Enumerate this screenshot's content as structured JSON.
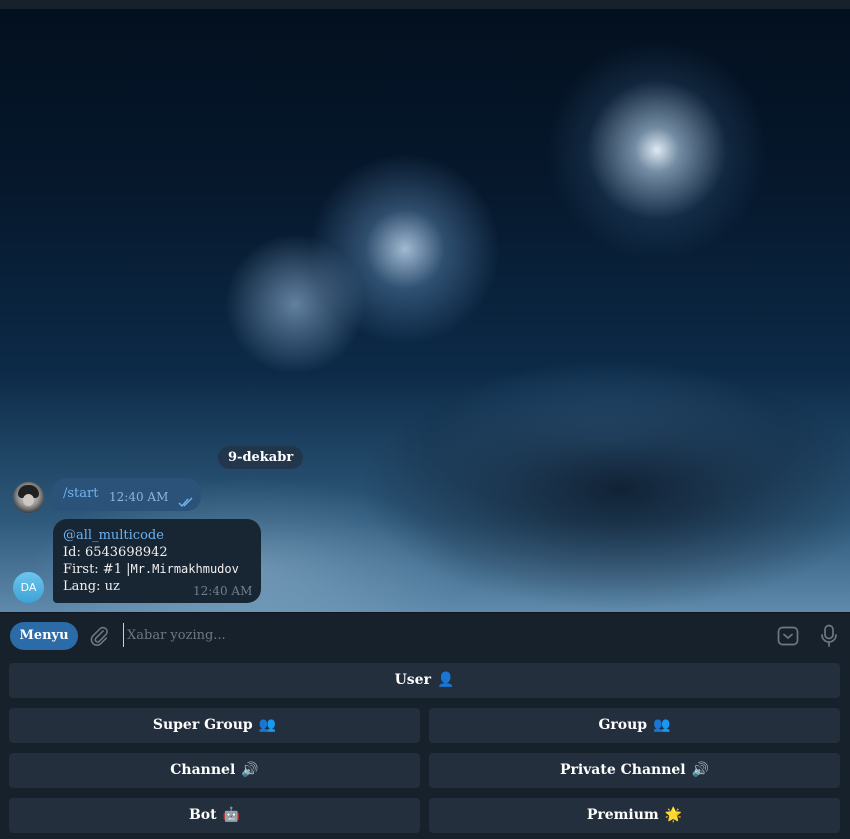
{
  "chat": {
    "date_separator": "9-dekabr",
    "messages": [
      {
        "direction": "out",
        "text": "/start",
        "time": "12:40 AM",
        "status": "read"
      },
      {
        "direction": "in",
        "sender_avatar_initials": "DA",
        "username": "@all_multicode",
        "lines": [
          "Id: 6543698942",
          "First: #1 |",
          "Lang: uz"
        ],
        "mono_name": "Mr.Mirmakhmudov",
        "time": "12:40 AM"
      }
    ]
  },
  "composer": {
    "menu_label": "Menyu",
    "placeholder": "Xabar yozing...",
    "value": ""
  },
  "keyboard": {
    "buttons": [
      {
        "label": "User",
        "emoji": "👤"
      },
      {
        "label": "Super Group",
        "emoji": "👥"
      },
      {
        "label": "Group",
        "emoji": "👥"
      },
      {
        "label": "Channel",
        "emoji": "🔊"
      },
      {
        "label": "Private Channel",
        "emoji": "🔊"
      },
      {
        "label": "Bot",
        "emoji": "🤖"
      },
      {
        "label": "Premium",
        "emoji": "🌟"
      }
    ]
  },
  "colors": {
    "app_bg": "#17212b",
    "outgoing_bubble": "#2b5278",
    "incoming_bubble": "#182533",
    "link": "#6ab3f3",
    "menu_button": "#2b6ba8",
    "keyboard_button": "#232f3d"
  }
}
